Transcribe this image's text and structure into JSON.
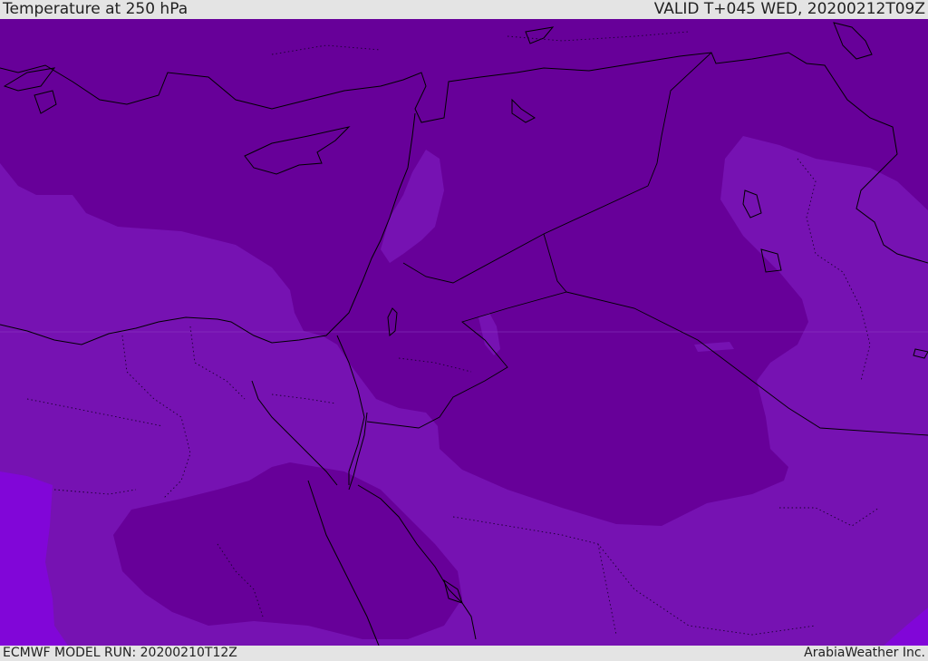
{
  "header": {
    "title": "Temperature at 250 hPa",
    "valid": "VALID T+045 WED, 20200212T09Z"
  },
  "footer": {
    "model_run": "ECMWF MODEL RUN: 20200210T12Z",
    "credit": "ArabiaWeather Inc."
  },
  "colors": {
    "cold_deep": "#670099",
    "cold_mid": "#7612b2",
    "warmer": "#8106d8",
    "coastline": "#000000",
    "bar": "#e4e4e4"
  }
}
